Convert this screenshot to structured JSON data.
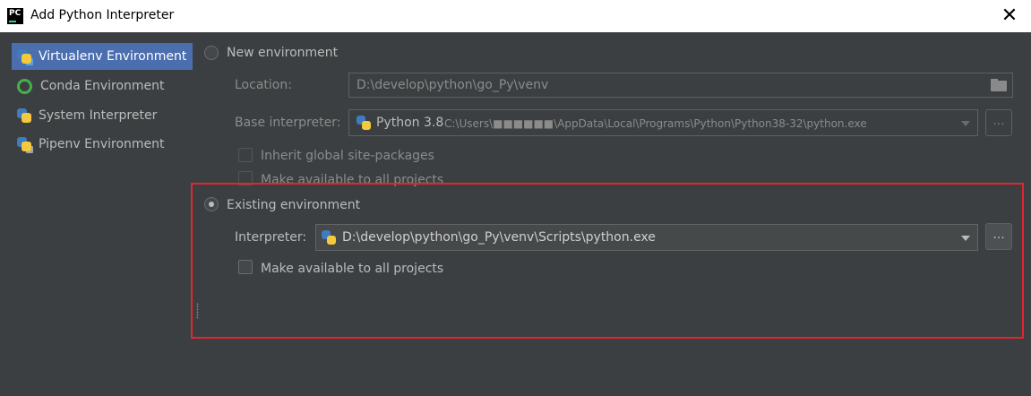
{
  "window": {
    "title": "Add Python Interpreter",
    "logo_text": "PC",
    "close_glyph": "✕"
  },
  "sidebar": {
    "items": [
      {
        "label": "Virtualenv Environment",
        "icon": "virtualenv-icon",
        "selected": true
      },
      {
        "label": "Conda Environment",
        "icon": "conda-icon"
      },
      {
        "label": "System Interpreter",
        "icon": "python-icon"
      },
      {
        "label": "Pipenv Environment",
        "icon": "pipenv-icon"
      }
    ]
  },
  "new_env": {
    "radio_label": "New environment",
    "location_label": "Location:",
    "location_value": "D:\\develop\\python\\go_Py\\venv",
    "base_label": "Base interpreter:",
    "base_version": "Python 3.8",
    "base_path": "C:\\Users\\■■■■■■\\AppData\\Local\\Programs\\Python\\Python38-32\\python.exe",
    "inherit_label": "Inherit global site-packages",
    "make_available_label": "Make available to all projects",
    "more_btn": "..."
  },
  "existing_env": {
    "radio_label": "Existing environment",
    "interpreter_label": "Interpreter:",
    "interpreter_value": "D:\\develop\\python\\go_Py\\venv\\Scripts\\python.exe",
    "make_available_label": "Make available to all projects",
    "more_btn": "..."
  },
  "colors": {
    "background": "#3c3f41",
    "selection": "#4b6eaf",
    "highlight_border": "#e0262e"
  }
}
